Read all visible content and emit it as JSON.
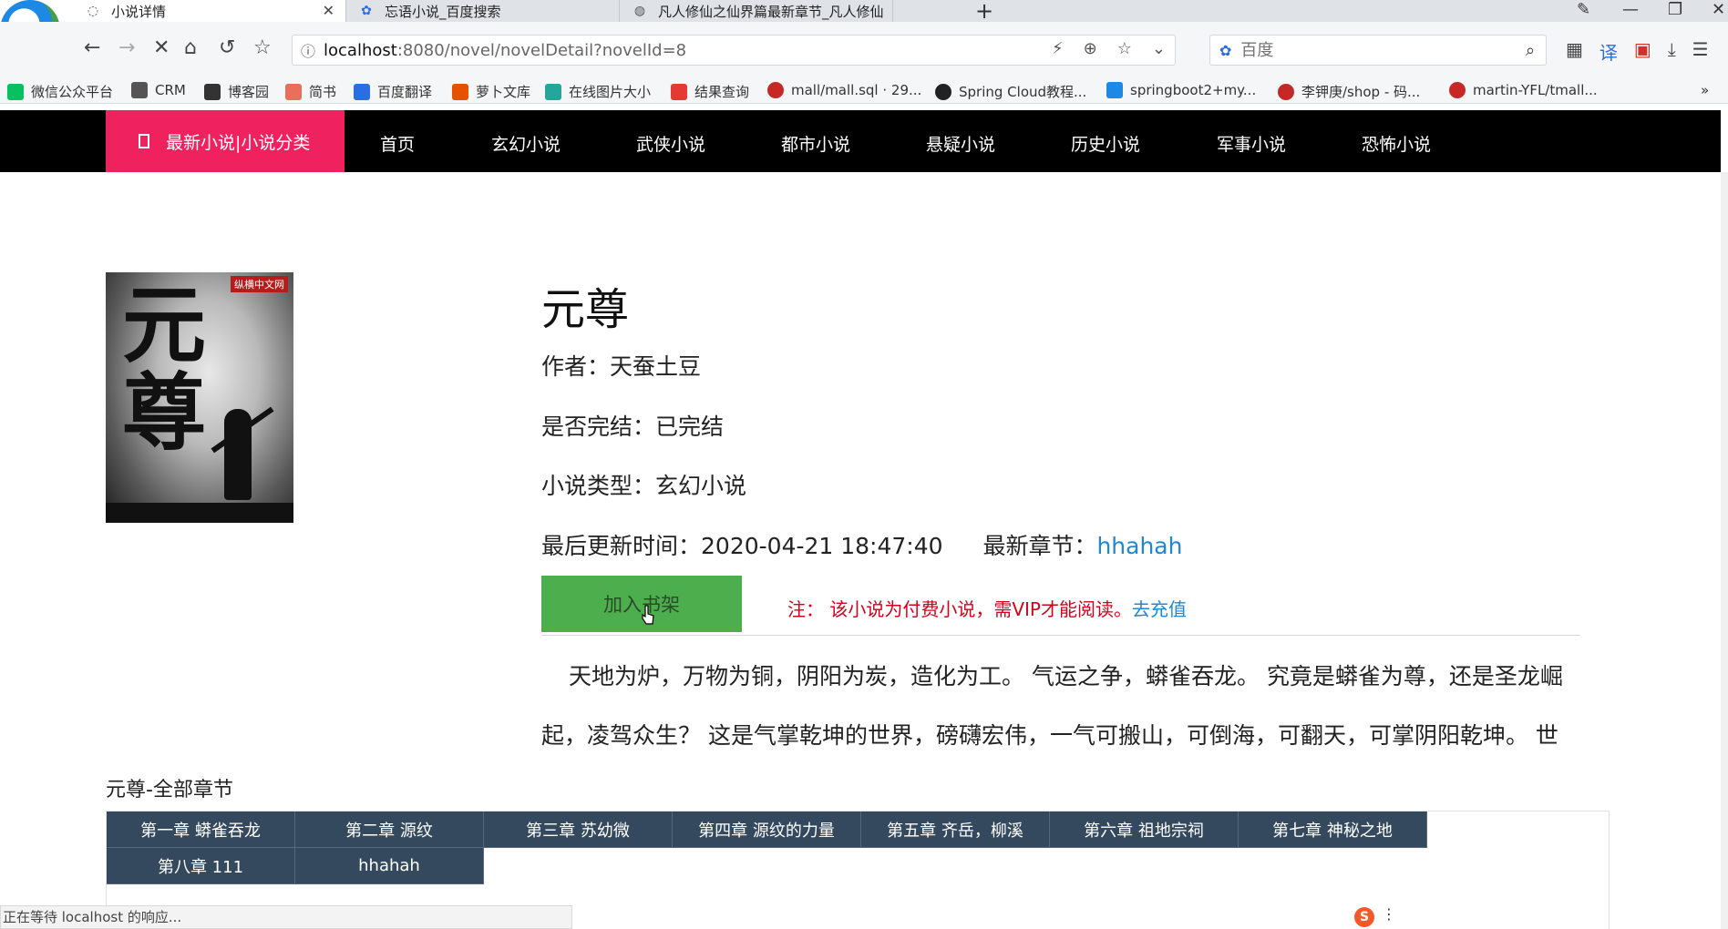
{
  "browser": {
    "logo_glyph": "e",
    "tabs": [
      {
        "title": "小说详情",
        "icon": "loading-spinner-icon",
        "active": true
      },
      {
        "title": "忘语小说_百度搜索",
        "icon": "baidu-paw-icon",
        "active": false
      },
      {
        "title": "凡人修仙之仙界篇最新章节_凡人修仙",
        "icon": "globe-icon",
        "active": false
      }
    ],
    "url_host": "localhost",
    "url_path": ":8080/novel/novelDetail?novelId=8",
    "search_placeholder": "百度",
    "bookmarks": [
      {
        "label": "微信公众平台",
        "color": "#07c160"
      },
      {
        "label": "CRM",
        "color": "#555555"
      },
      {
        "label": "博客园",
        "color": "#333333"
      },
      {
        "label": "简书",
        "color": "#ea6f5a"
      },
      {
        "label": "百度翻译",
        "color": "#2b6de5"
      },
      {
        "label": "萝卜文库",
        "color": "#e65100"
      },
      {
        "label": "在线图片大小",
        "color": "#26a69a"
      },
      {
        "label": "结果查询",
        "color": "#e53935"
      },
      {
        "label": "mall/mall.sql · 29...",
        "color": "#c62828"
      },
      {
        "label": "Spring Cloud教程...",
        "color": "#222222"
      },
      {
        "label": "springboot2+my...",
        "color": "#1e88e5"
      },
      {
        "label": "李钾庚/shop - 码...",
        "color": "#c62828"
      },
      {
        "label": "martin-YFL/tmall...",
        "color": "#c62828"
      }
    ],
    "status_text": "正在等待 localhost 的响应..."
  },
  "site_nav": {
    "brand": "最新小说|小说分类",
    "items": [
      "首页",
      "玄幻小说",
      "武侠小说",
      "都市小说",
      "悬疑小说",
      "历史小说",
      "军事小说",
      "恐怖小说"
    ]
  },
  "novel": {
    "cover_title_text": "元尊",
    "cover_publisher": "纵横中文网",
    "title": "元尊",
    "author_label": "作者：",
    "author": "天蚕土豆",
    "finished_label": "是否完结：",
    "finished": "已完结",
    "type_label": "小说类型：",
    "type": "玄幻小说",
    "updated_label": "最后更新时间：",
    "updated": "2020-04-21 18:47:40",
    "latest_label": "最新章节：",
    "latest_chapter": "hhahah",
    "add_button": "加入书架",
    "note": "注：  该小说为付费小说，需VIP才能阅读。",
    "recharge_link": "去充值",
    "description": "天地为炉，万物为铜，阴阳为炭，造化为工。 气运之争，蟒雀吞龙。 究竟是蟒雀为尊，还是圣龙崛起，凌驾众生？ 这是气掌乾坤的世界，磅礴宏伟，一气可搬山，可倒海，可翻天，可掌阴阳乾坤。 世间"
  },
  "chapters": {
    "heading": "元尊-全部章节",
    "items": [
      "第一章 蟒雀吞龙",
      "第二章 源纹",
      "第三章 苏幼微",
      "第四章 源纹的力量",
      "第五章 齐岳，柳溪",
      "第六章 祖地宗祠",
      "第七章 神秘之地",
      "第八章 111",
      "hhahah"
    ]
  },
  "colors": {
    "brand_pink": "#f0215f",
    "nav_black": "#000000",
    "button_green": "#4cae4c",
    "note_red": "#d0021b",
    "link_blue": "#1e88d3",
    "chapter_bg": "#34495e"
  }
}
